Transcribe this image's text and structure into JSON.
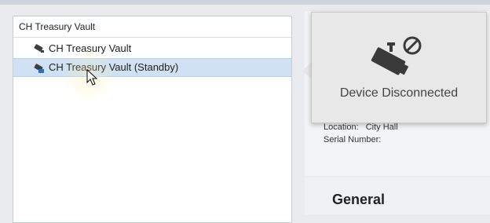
{
  "tree": {
    "header": "CH Treasury Vault",
    "items": [
      {
        "label": "CH Treasury Vault",
        "icon": "camera-icon",
        "selected": false
      },
      {
        "label": "CH Treasury Vault (Standby)",
        "icon": "camera-standby-icon",
        "selected": true
      }
    ]
  },
  "popup": {
    "icon": "camera-disconnected-icon",
    "message": "Device Disconnected"
  },
  "details": {
    "location_label": "Location:",
    "location_value": "City Hall",
    "serial_label": "Serial Number:",
    "serial_value": ""
  },
  "general": {
    "title": "General"
  },
  "colors": {
    "selection": "#cfe1f3",
    "popup_bg": "#e8e8e8",
    "icon_gray": "#3a3a3a"
  }
}
